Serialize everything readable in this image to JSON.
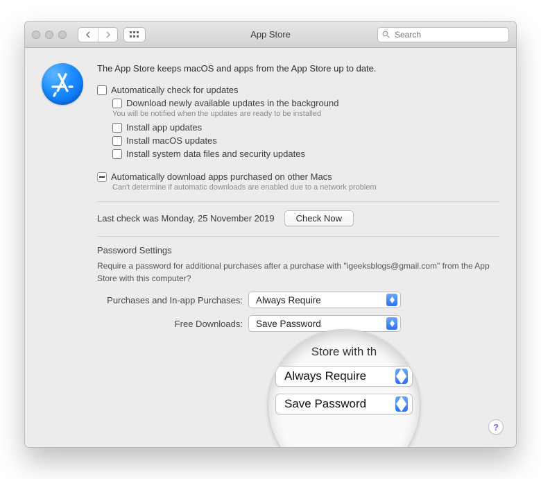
{
  "window": {
    "title": "App Store"
  },
  "search": {
    "placeholder": "Search"
  },
  "header": {
    "description": "The App Store keeps macOS and apps from the App Store up to date."
  },
  "autoCheck": {
    "label": "Automatically check for updates",
    "download": {
      "label": "Download newly available updates in the background",
      "hint": "You will be notified when the updates are ready to be installed"
    },
    "installApp": "Install app updates",
    "installMacOS": "Install macOS updates",
    "installSystemData": "Install system data files and security updates"
  },
  "autoDownloadPurchased": {
    "label": "Automatically download apps purchased on other Macs",
    "hint": "Can't determine if automatic downloads are enabled due to a network problem"
  },
  "lastCheck": {
    "text": "Last check was Monday, 25 November 2019",
    "button": "Check Now"
  },
  "passwordSettings": {
    "title": "Password Settings",
    "requireText": "Require a password for additional purchases after a purchase with \"igeeksblogs@gmail.com\" from the App Store with this computer?",
    "purchases": {
      "label": "Purchases and In-app Purchases:",
      "value": "Always Require"
    },
    "free": {
      "label": "Free Downloads:",
      "value": "Save Password"
    }
  },
  "magnifier": {
    "topText": "Store with th",
    "dd1": "Always Require",
    "dd2": "Save Password"
  },
  "help": "?"
}
